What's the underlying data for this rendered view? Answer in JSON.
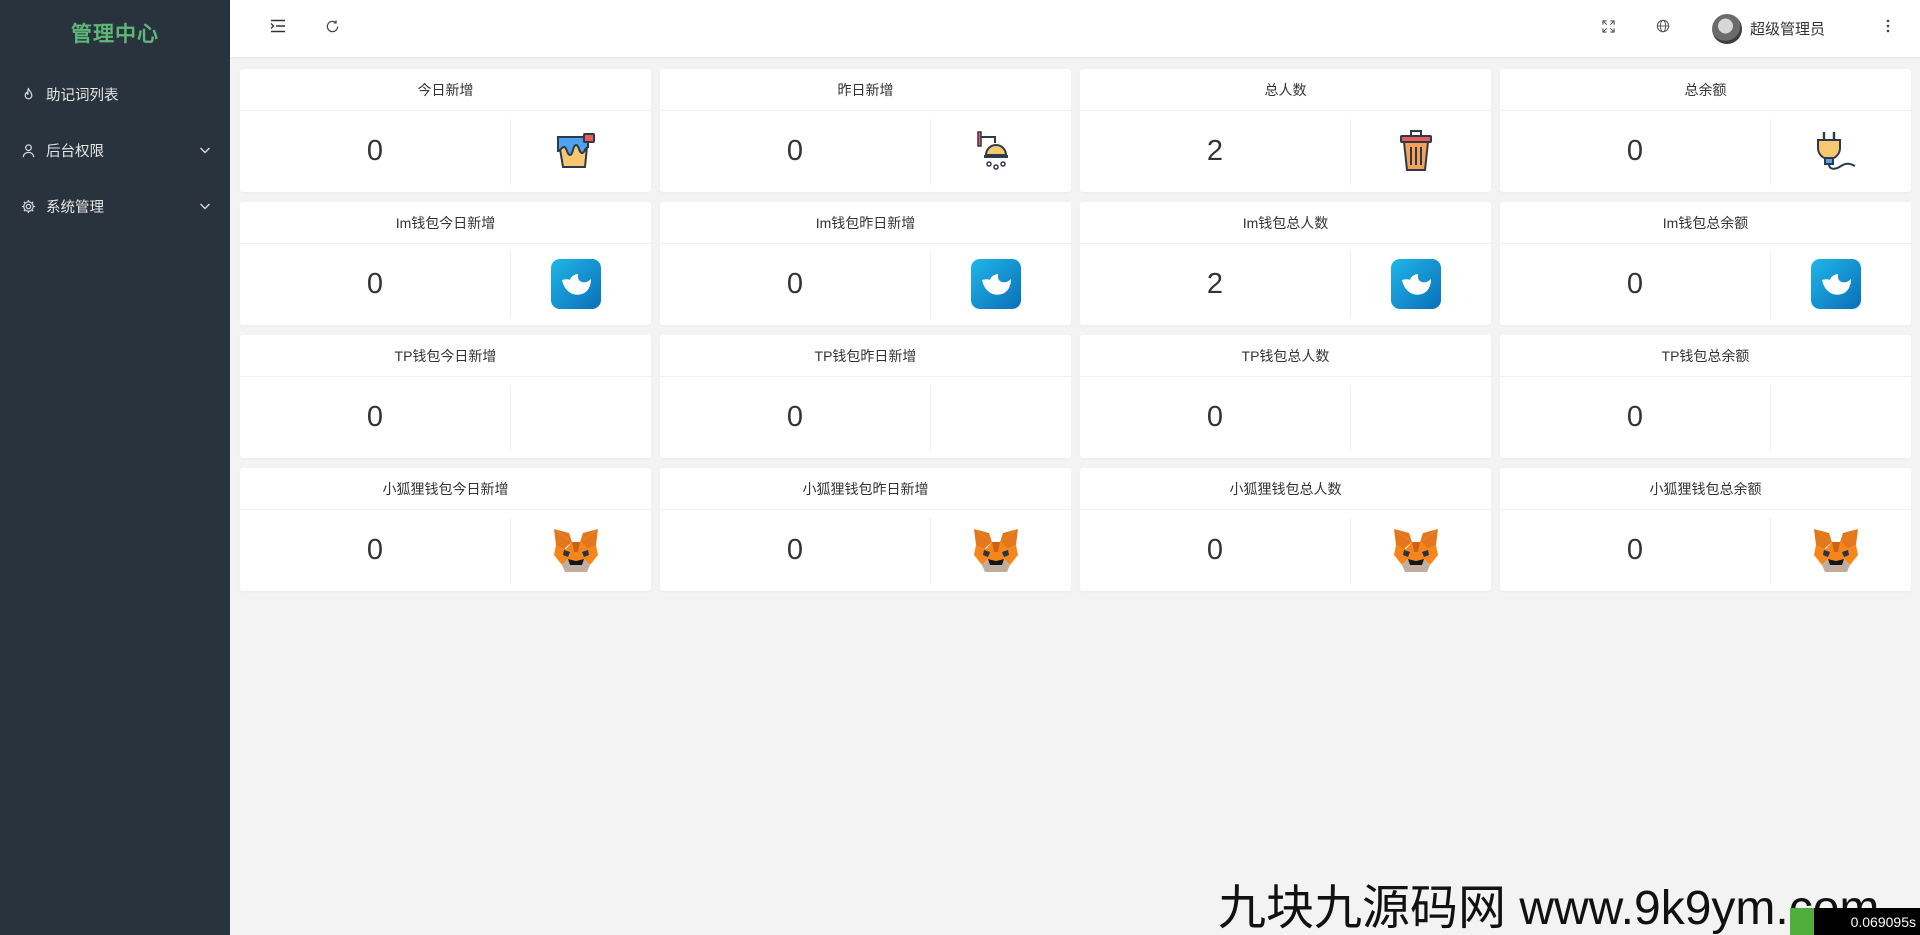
{
  "sidebar": {
    "brand": "管理中心",
    "items": [
      {
        "label": "助记词列表",
        "icon": "fire-icon",
        "expandable": false
      },
      {
        "label": "后台权限",
        "icon": "user-icon",
        "expandable": true
      },
      {
        "label": "系统管理",
        "icon": "gear-icon",
        "expandable": true
      }
    ]
  },
  "header": {
    "user_name": "超级管理员",
    "icons": [
      "menu-fold-icon",
      "refresh-icon",
      "fullscreen-icon",
      "globe-icon",
      "avatar",
      "more-vertical-icon"
    ]
  },
  "cards": [
    {
      "title": "今日新增",
      "value": "0",
      "icon": "paint-bucket-icon"
    },
    {
      "title": "昨日新增",
      "value": "0",
      "icon": "shower-icon"
    },
    {
      "title": "总人数",
      "value": "2",
      "icon": "trash-bin-icon"
    },
    {
      "title": "总余额",
      "value": "0",
      "icon": "plug-icon"
    },
    {
      "title": "Im钱包今日新增",
      "value": "0",
      "icon": "imtoken-icon"
    },
    {
      "title": "Im钱包昨日新增",
      "value": "0",
      "icon": "imtoken-icon"
    },
    {
      "title": "Im钱包总人数",
      "value": "2",
      "icon": "imtoken-icon"
    },
    {
      "title": "Im钱包总余额",
      "value": "0",
      "icon": "imtoken-icon"
    },
    {
      "title": "TP钱包今日新增",
      "value": "0",
      "icon": ""
    },
    {
      "title": "TP钱包昨日新增",
      "value": "0",
      "icon": ""
    },
    {
      "title": "TP钱包总人数",
      "value": "0",
      "icon": ""
    },
    {
      "title": "TP钱包总余额",
      "value": "0",
      "icon": ""
    },
    {
      "title": "小狐狸钱包今日新增",
      "value": "0",
      "icon": "metamask-fox-icon"
    },
    {
      "title": "小狐狸钱包昨日新增",
      "value": "0",
      "icon": "metamask-fox-icon"
    },
    {
      "title": "小狐狸钱包总人数",
      "value": "0",
      "icon": "metamask-fox-icon"
    },
    {
      "title": "小狐狸钱包总余额",
      "value": "0",
      "icon": "metamask-fox-icon"
    }
  ],
  "watermark": "九块九源码网 www.9k9ym.com",
  "timer": "0.069095s",
  "colors": {
    "sidebar_bg": "#28333e",
    "brand": "#5fb878",
    "page_bg": "#f3f3f3"
  }
}
